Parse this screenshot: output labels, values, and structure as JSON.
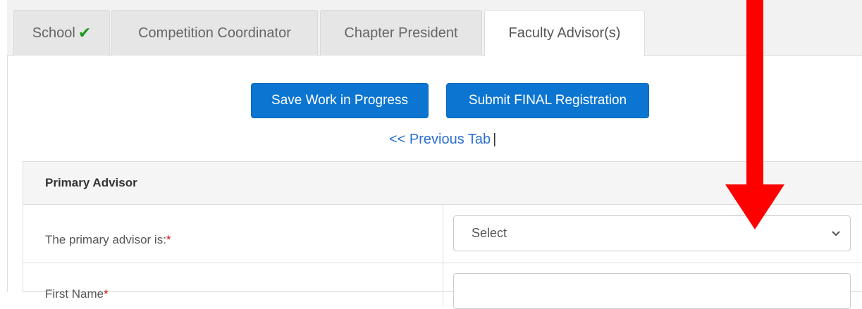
{
  "tabs": [
    {
      "label": "School",
      "completed": true
    },
    {
      "label": "Competition Coordinator"
    },
    {
      "label": "Chapter President"
    },
    {
      "label": "Faculty Advisor(s)",
      "active": true
    }
  ],
  "actions": {
    "save_label": "Save Work in Progress",
    "submit_label": "Submit FINAL Registration",
    "previous_tab_label": "<< Previous Tab",
    "separator": "|"
  },
  "primary_advisor": {
    "heading": "Primary Advisor",
    "advisor_role_label": "The primary advisor is:",
    "required_mark": "*",
    "advisor_role_select_value": "Select",
    "first_name_label": "First Name",
    "first_name_value": ""
  },
  "colors": {
    "accent_blue": "#0b75d1",
    "link_blue": "#2a6fd0",
    "required_red": "#d01010",
    "annotation_arrow_red": "#ff0000",
    "check_green": "#1a9a1a"
  },
  "icons": [
    "checkmark-icon",
    "chevron-down-icon",
    "red-arrow-annotation"
  ]
}
